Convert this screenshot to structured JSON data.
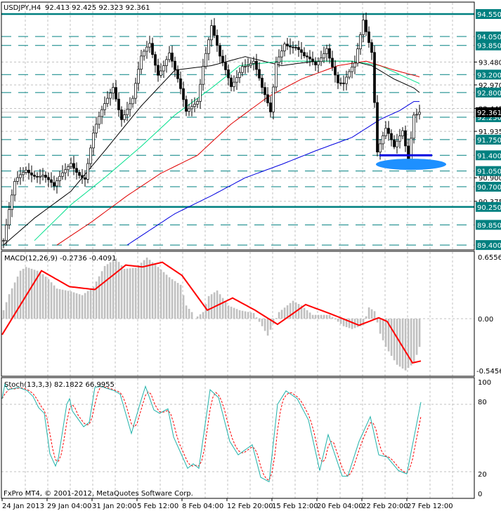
{
  "header": {
    "symbol": "USDJPY,H4",
    "ohlc": "92.413 92.425 92.323 92.361"
  },
  "footer": {
    "copyright": "FxPro MT4, © 2001-2012, MetaQuotes Software Corp."
  },
  "colors": {
    "level": "#008080",
    "grid": "#c0c0c0",
    "ma_fast": "#000000",
    "ma_mid": "#00e08c",
    "ma_slow": "#e00000",
    "ma_long": "#0000e0",
    "ellipse": "#1e90ff",
    "macd_hist": "#c0c0c0",
    "macd_signal": "#ff0000",
    "stoch_main": "#20b2aa",
    "stoch_signal": "#ff0000"
  },
  "price_axis": {
    "grid_labels": [
      "93.480",
      "92.970",
      "92.445",
      "91.935",
      "90.900",
      "90.375"
    ],
    "current_price": "92.361",
    "solid_levels": [
      "94.550",
      "90.250"
    ],
    "dashed_levels": [
      "94.050",
      "93.850",
      "93.200",
      "92.800",
      "92.250",
      "91.750",
      "91.400",
      "91.050",
      "90.700",
      "89.850",
      "89.400"
    ]
  },
  "support_marker": {
    "level": 91.4,
    "zone_center": 91.2
  },
  "date_axis": [
    "24 Jan 2013",
    "29 Jan 04:00",
    "31 Jan 20:00",
    "5 Feb 12:00",
    "8 Feb 04:00",
    "12 Feb 20:00",
    "15 Feb 12:00",
    "20 Feb 04:00",
    "22 Feb 20:00",
    "27 Feb 12:00"
  ],
  "macd": {
    "title": "MACD(12,26,9) -0.2736 -0.4091",
    "axis": [
      "0.6556",
      "0.00",
      "-0.5456"
    ]
  },
  "stoch": {
    "title": "Stoch(13,3,3) 82.1822 66.9955",
    "axis": [
      "100",
      "80",
      "20",
      "0"
    ]
  },
  "chart_data": {
    "type": "candlestick",
    "bars": 149,
    "price_path": [
      [
        0,
        89.5
      ],
      [
        4,
        90.7
      ],
      [
        8,
        91.1
      ],
      [
        14,
        91.0
      ],
      [
        18,
        90.6
      ],
      [
        24,
        91.3
      ],
      [
        29,
        90.9
      ],
      [
        32,
        91.8
      ],
      [
        36,
        92.5
      ],
      [
        39,
        93.0
      ],
      [
        42,
        92.3
      ],
      [
        46,
        92.6
      ],
      [
        49,
        93.5
      ],
      [
        52,
        93.9
      ],
      [
        55,
        93.3
      ],
      [
        59,
        93.7
      ],
      [
        62,
        93.0
      ],
      [
        65,
        92.3
      ],
      [
        69,
        92.7
      ],
      [
        71,
        93.5
      ],
      [
        74,
        94.3
      ],
      [
        77,
        93.5
      ],
      [
        81,
        92.9
      ],
      [
        85,
        93.5
      ],
      [
        89,
        93.5
      ],
      [
        92,
        92.8
      ],
      [
        95,
        92.3
      ],
      [
        97,
        93.5
      ],
      [
        100,
        94.0
      ],
      [
        104,
        93.8
      ],
      [
        107,
        93.5
      ],
      [
        111,
        93.4
      ],
      [
        115,
        93.9
      ],
      [
        119,
        93.0
      ],
      [
        121,
        92.9
      ],
      [
        125,
        93.4
      ],
      [
        128,
        94.5
      ],
      [
        131,
        93.8
      ],
      [
        133,
        91.5
      ],
      [
        136,
        91.9
      ],
      [
        139,
        91.5
      ],
      [
        142,
        92.0
      ],
      [
        144,
        91.4
      ],
      [
        146,
        92.4
      ],
      [
        148,
        92.36
      ]
    ],
    "ma_fast": [
      [
        0,
        89.4
      ],
      [
        11,
        90.0
      ],
      [
        24,
        90.6
      ],
      [
        36,
        91.5
      ],
      [
        49,
        92.5
      ],
      [
        61,
        93.3
      ],
      [
        74,
        93.4
      ],
      [
        86,
        93.6
      ],
      [
        99,
        93.4
      ],
      [
        111,
        93.5
      ],
      [
        124,
        93.5
      ],
      [
        131,
        93.4
      ],
      [
        139,
        93.1
      ],
      [
        146,
        92.9
      ],
      [
        148,
        92.8
      ]
    ],
    "ma_mid": [
      [
        11,
        89.5
      ],
      [
        24,
        90.3
      ],
      [
        36,
        90.9
      ],
      [
        49,
        91.6
      ],
      [
        61,
        92.3
      ],
      [
        74,
        92.9
      ],
      [
        84,
        93.4
      ],
      [
        99,
        93.5
      ],
      [
        111,
        93.5
      ],
      [
        124,
        93.5
      ],
      [
        134,
        93.4
      ],
      [
        141,
        93.2
      ],
      [
        148,
        93.0
      ]
    ],
    "ma_slow": [
      [
        19,
        89.4
      ],
      [
        31,
        89.9
      ],
      [
        44,
        90.5
      ],
      [
        56,
        91.0
      ],
      [
        69,
        91.4
      ],
      [
        81,
        92.1
      ],
      [
        94,
        92.7
      ],
      [
        106,
        93.1
      ],
      [
        119,
        93.4
      ],
      [
        129,
        93.5
      ],
      [
        139,
        93.3
      ],
      [
        148,
        93.15
      ]
    ],
    "ma_long": [
      [
        44,
        89.4
      ],
      [
        61,
        90.1
      ],
      [
        74,
        90.5
      ],
      [
        86,
        90.9
      ],
      [
        99,
        91.2
      ],
      [
        111,
        91.5
      ],
      [
        124,
        91.8
      ],
      [
        134,
        92.2
      ],
      [
        141,
        92.4
      ],
      [
        146,
        92.6
      ],
      [
        148,
        92.6
      ]
    ],
    "macd_hist": [
      [
        1,
        0.09
      ],
      [
        3,
        0.26
      ],
      [
        7,
        0.51
      ],
      [
        9,
        0.55
      ],
      [
        14,
        0.5
      ],
      [
        17,
        0.42
      ],
      [
        20,
        0.32
      ],
      [
        25,
        0.29
      ],
      [
        29,
        0.25
      ],
      [
        33,
        0.34
      ],
      [
        37,
        0.56
      ],
      [
        41,
        0.64
      ],
      [
        44,
        0.53
      ],
      [
        48,
        0.54
      ],
      [
        52,
        0.65
      ],
      [
        56,
        0.55
      ],
      [
        60,
        0.44
      ],
      [
        64,
        0.36
      ],
      [
        66,
        0.14
      ],
      [
        68,
        0.07
      ],
      [
        69,
        0.0
      ],
      [
        72,
        0.07
      ],
      [
        74,
        0.24
      ],
      [
        77,
        0.3
      ],
      [
        81,
        0.14
      ],
      [
        85,
        0.09
      ],
      [
        90,
        0.06
      ],
      [
        93,
        -0.08
      ],
      [
        95,
        -0.18
      ],
      [
        99,
        0.07
      ],
      [
        104,
        0.19
      ],
      [
        107,
        0.14
      ],
      [
        111,
        0.04
      ],
      [
        117,
        0.04
      ],
      [
        122,
        -0.08
      ],
      [
        125,
        -0.11
      ],
      [
        129,
        -0.07
      ],
      [
        131,
        0.12
      ],
      [
        133,
        0.08
      ],
      [
        135,
        -0.16
      ],
      [
        137,
        -0.3
      ],
      [
        141,
        -0.49
      ],
      [
        144,
        -0.55
      ],
      [
        147,
        -0.47
      ],
      [
        149,
        -0.3
      ]
    ],
    "macd_signal": [
      [
        0,
        -0.17
      ],
      [
        14,
        0.51
      ],
      [
        24,
        0.34
      ],
      [
        33,
        0.31
      ],
      [
        44,
        0.57
      ],
      [
        50,
        0.55
      ],
      [
        57,
        0.6
      ],
      [
        64,
        0.46
      ],
      [
        73,
        0.09
      ],
      [
        82,
        0.22
      ],
      [
        90,
        0.09
      ],
      [
        98,
        -0.06
      ],
      [
        108,
        0.15
      ],
      [
        117,
        0.05
      ],
      [
        127,
        -0.07
      ],
      [
        134,
        0.01
      ],
      [
        137,
        -0.03
      ],
      [
        146,
        -0.47
      ],
      [
        149,
        -0.45
      ]
    ],
    "stoch_main": [
      [
        0,
        85
      ],
      [
        1,
        98
      ],
      [
        2,
        93
      ],
      [
        6,
        95
      ],
      [
        9,
        92
      ],
      [
        11,
        87
      ],
      [
        13,
        77
      ],
      [
        15,
        72
      ],
      [
        17,
        36
      ],
      [
        19,
        25
      ],
      [
        20,
        32
      ],
      [
        23,
        80
      ],
      [
        24,
        85
      ],
      [
        25,
        74
      ],
      [
        29,
        60
      ],
      [
        31,
        64
      ],
      [
        33,
        95
      ],
      [
        35,
        96
      ],
      [
        40,
        92
      ],
      [
        42,
        89
      ],
      [
        46,
        54
      ],
      [
        49,
        80
      ],
      [
        51,
        96
      ],
      [
        54,
        75
      ],
      [
        56,
        72
      ],
      [
        59,
        76
      ],
      [
        61,
        51
      ],
      [
        66,
        23
      ],
      [
        68,
        27
      ],
      [
        70,
        23
      ],
      [
        74,
        93
      ],
      [
        77,
        86
      ],
      [
        81,
        47
      ],
      [
        84,
        35
      ],
      [
        89,
        44
      ],
      [
        92,
        15
      ],
      [
        95,
        11
      ],
      [
        98,
        80
      ],
      [
        101,
        92
      ],
      [
        105,
        85
      ],
      [
        109,
        66
      ],
      [
        113,
        21
      ],
      [
        116,
        53
      ],
      [
        121,
        16
      ],
      [
        123,
        16
      ],
      [
        127,
        47
      ],
      [
        131,
        69
      ],
      [
        134,
        35
      ],
      [
        137,
        33
      ],
      [
        141,
        21
      ],
      [
        144,
        18
      ],
      [
        149,
        82
      ]
    ]
  }
}
